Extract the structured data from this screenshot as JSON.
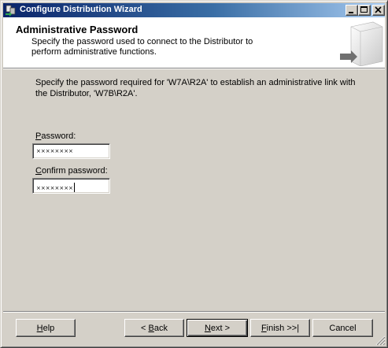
{
  "window": {
    "title": "Configure Distribution Wizard",
    "controls": [
      "minimize-icon",
      "maximize-icon",
      "close-icon"
    ]
  },
  "header": {
    "title": "Administrative Password",
    "description": "Specify the password used to connect to the Distributor to perform administrative functions."
  },
  "body": {
    "instruction": "Specify the password required for 'W7A\\R2A' to establish an administrative link with the Distributor, 'W7B\\R2A'.",
    "password": {
      "label_accel": "P",
      "label_rest": "assword:",
      "value": "××××××××"
    },
    "confirm": {
      "label_accel": "C",
      "label_rest": "onfirm password:",
      "value": "××××××××"
    }
  },
  "footer": {
    "help": {
      "accel": "H",
      "rest": "elp"
    },
    "back": {
      "prefix": "< ",
      "accel": "B",
      "rest": "ack"
    },
    "next": {
      "accel": "N",
      "rest": "ext >"
    },
    "finish": {
      "accel": "F",
      "rest": "inish >>|"
    },
    "cancel": {
      "label": "Cancel"
    }
  },
  "colors": {
    "titlebar_start": "#0a246a",
    "titlebar_end": "#a6caf0",
    "face": "#d4d0c8",
    "header_bg": "#ffffff"
  }
}
